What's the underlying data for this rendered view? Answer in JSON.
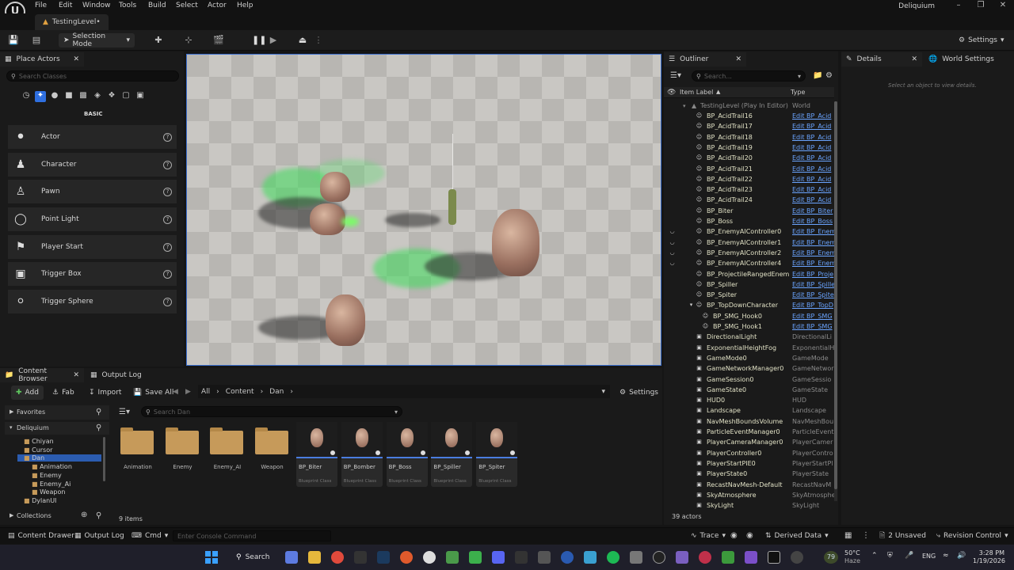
{
  "menubar": {
    "items": [
      "File",
      "Edit",
      "Window",
      "Tools",
      "Build",
      "Select",
      "Actor",
      "Help"
    ],
    "app_title": "Deliquium"
  },
  "level_tab": "TestingLevel•",
  "toolbar": {
    "selection_mode": "Selection Mode",
    "settings": "Settings"
  },
  "place_actors": {
    "tab": "Place Actors",
    "search_placeholder": "Search Classes",
    "category": "BASIC",
    "items": [
      "Actor",
      "Character",
      "Pawn",
      "Point Light",
      "Player Start",
      "Trigger Box",
      "Trigger Sphere"
    ]
  },
  "outliner": {
    "tab": "Outliner",
    "search_placeholder": "Search...",
    "col_label": "Item Label",
    "col_type": "Type",
    "root": {
      "label": "TestingLevel (Play In Editor)",
      "type": "World"
    },
    "rows": [
      {
        "label": "BP_AcidTrail16",
        "type": "Edit BP_Acid",
        "link": true,
        "indent": 1
      },
      {
        "label": "BP_AcidTrail17",
        "type": "Edit BP_Acid",
        "link": true,
        "indent": 1
      },
      {
        "label": "BP_AcidTrail18",
        "type": "Edit BP_Acid",
        "link": true,
        "indent": 1
      },
      {
        "label": "BP_AcidTrail19",
        "type": "Edit BP_Acid",
        "link": true,
        "indent": 1
      },
      {
        "label": "BP_AcidTrail20",
        "type": "Edit BP_Acid",
        "link": true,
        "indent": 1
      },
      {
        "label": "BP_AcidTrail21",
        "type": "Edit BP_Acid",
        "link": true,
        "indent": 1
      },
      {
        "label": "BP_AcidTrail22",
        "type": "Edit BP_Acid",
        "link": true,
        "indent": 1
      },
      {
        "label": "BP_AcidTrail23",
        "type": "Edit BP_Acid",
        "link": true,
        "indent": 1
      },
      {
        "label": "BP_AcidTrail24",
        "type": "Edit BP_Acid",
        "link": true,
        "indent": 1
      },
      {
        "label": "BP_Biter",
        "type": "Edit BP_Biter",
        "link": true,
        "indent": 1
      },
      {
        "label": "BP_Boss",
        "type": "Edit BP_Boss",
        "link": true,
        "indent": 1
      },
      {
        "label": "BP_EnemyAIController0",
        "type": "Edit BP_Enem",
        "link": true,
        "indent": 1
      },
      {
        "label": "BP_EnemyAIController1",
        "type": "Edit BP_Enem",
        "link": true,
        "indent": 1
      },
      {
        "label": "BP_EnemyAIController2",
        "type": "Edit BP_Enem",
        "link": true,
        "indent": 1
      },
      {
        "label": "BP_EnemyAIController4",
        "type": "Edit BP_Enem",
        "link": true,
        "indent": 1
      },
      {
        "label": "BP_ProjectileRangedEnemy",
        "type": "Edit BP_Proje",
        "link": true,
        "indent": 1
      },
      {
        "label": "BP_Spiller",
        "type": "Edit BP_Spille",
        "link": true,
        "indent": 1
      },
      {
        "label": "BP_Spiter",
        "type": "Edit BP_Spite",
        "link": true,
        "indent": 1
      },
      {
        "label": "BP_TopDownCharacter",
        "type": "Edit BP_TopD",
        "link": true,
        "indent": 1
      },
      {
        "label": "BP_SMG_Hook0",
        "type": "Edit BP_SMG",
        "link": true,
        "indent": 2
      },
      {
        "label": "BP_SMG_Hook1",
        "type": "Edit BP_SMG",
        "link": true,
        "indent": 2
      },
      {
        "label": "DirectionalLight",
        "type": "DirectionalLi",
        "link": false,
        "indent": 1
      },
      {
        "label": "ExponentialHeightFog",
        "type": "ExponentialH",
        "link": false,
        "indent": 1
      },
      {
        "label": "GameMode0",
        "type": "GameMode",
        "link": false,
        "indent": 1
      },
      {
        "label": "GameNetworkManager0",
        "type": "GameNetwor",
        "link": false,
        "indent": 1
      },
      {
        "label": "GameSession0",
        "type": "GameSessio",
        "link": false,
        "indent": 1
      },
      {
        "label": "GameState0",
        "type": "GameState",
        "link": false,
        "indent": 1
      },
      {
        "label": "HUD0",
        "type": "HUD",
        "link": false,
        "indent": 1
      },
      {
        "label": "Landscape",
        "type": "Landscape",
        "link": false,
        "indent": 1
      },
      {
        "label": "NavMeshBoundsVolume",
        "type": "NavMeshBou",
        "link": false,
        "indent": 1
      },
      {
        "label": "ParticleEventManager0",
        "type": "ParticleEvent",
        "link": false,
        "indent": 1
      },
      {
        "label": "PlayerCameraManager0",
        "type": "PlayerCamer",
        "link": false,
        "indent": 1
      },
      {
        "label": "PlayerController0",
        "type": "PlayerContro",
        "link": false,
        "indent": 1
      },
      {
        "label": "PlayerStartPIE0",
        "type": "PlayerStartPl",
        "link": false,
        "indent": 1
      },
      {
        "label": "PlayerState0",
        "type": "PlayerState",
        "link": false,
        "indent": 1
      },
      {
        "label": "RecastNavMesh-Default",
        "type": "RecastNavM",
        "link": false,
        "indent": 1
      },
      {
        "label": "SkyAtmosphere",
        "type": "SkyAtmosphe",
        "link": false,
        "indent": 1
      },
      {
        "label": "SkyLight",
        "type": "SkyLight",
        "link": false,
        "indent": 1
      }
    ],
    "count": "39 actors"
  },
  "details": {
    "tab": "Details",
    "world_settings_tab": "World Settings",
    "empty_hint": "Select an object to view details."
  },
  "content_browser": {
    "tab": "Content Browser",
    "output_log_tab": "Output Log",
    "add": "Add",
    "fab": "Fab",
    "import": "Import",
    "save_all": "Save All",
    "path": [
      "All",
      "Content",
      "Dan"
    ],
    "settings": "Settings",
    "favorites": "Favorites",
    "project": "Deliquium",
    "tree": [
      {
        "label": "Chiyan",
        "indent": 1
      },
      {
        "label": "Cursor",
        "indent": 1
      },
      {
        "label": "Dan",
        "indent": 1,
        "selected": true
      },
      {
        "label": "Animation",
        "indent": 2
      },
      {
        "label": "Enemy",
        "indent": 2
      },
      {
        "label": "Enemy_Ai",
        "indent": 2
      },
      {
        "label": "Weapon",
        "indent": 2
      },
      {
        "label": "DylanUI",
        "indent": 1
      }
    ],
    "collections": "Collections",
    "search_placeholder": "Search Dan",
    "folders": [
      "Animation",
      "Enemy",
      "Enemy_AI",
      "Weapon"
    ],
    "assets": [
      {
        "name": "BP_Biter",
        "kind": "Blueprint Class"
      },
      {
        "name": "BP_Bomber",
        "kind": "Blueprint Class"
      },
      {
        "name": "BP_Boss",
        "kind": "Blueprint Class"
      },
      {
        "name": "BP_Spiller",
        "kind": "Blueprint Class"
      },
      {
        "name": "BP_Spiter",
        "kind": "Blueprint Class"
      }
    ],
    "item_count": "9 items"
  },
  "statusbar": {
    "content_drawer": "Content Drawer",
    "output_log": "Output Log",
    "cmd": "Cmd",
    "console_placeholder": "Enter Console Command",
    "trace": "Trace",
    "derived_data": "Derived Data",
    "unsaved": "2 Unsaved",
    "revision_control": "Revision Control"
  },
  "taskbar": {
    "search": "Search",
    "weather_temp": "50°C",
    "weather_desc": "Haze",
    "lang": "ENG",
    "time": "3:28 PM",
    "date": "1/19/2026",
    "badge": "79"
  }
}
